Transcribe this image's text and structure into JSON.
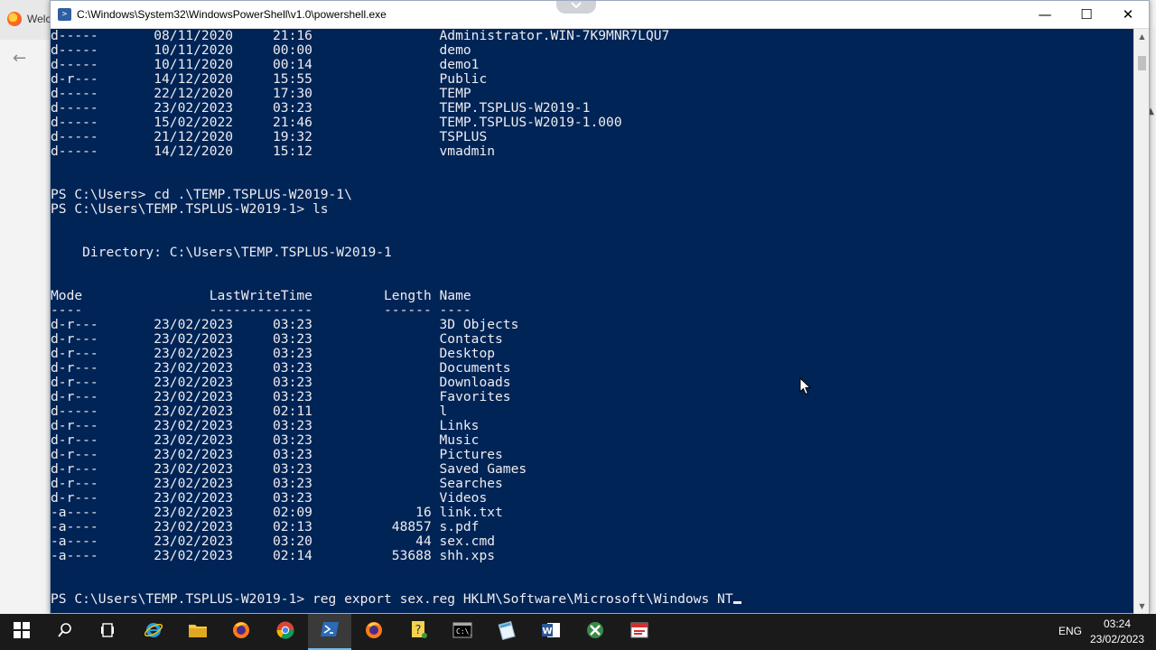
{
  "background_browser": {
    "tab_title": "Welc",
    "back_glyph": "←"
  },
  "window": {
    "title": "C:\\Windows\\System32\\WindowsPowerShell\\v1.0\\powershell.exe",
    "minimize_glyph": "—",
    "maximize_glyph": "☐",
    "close_glyph": "✕"
  },
  "console": {
    "lines": [
      "d-----       08/11/2020     21:16                Administrator.WIN-7K9MNR7LQU7",
      "d-----       10/11/2020     00:00                demo",
      "d-----       10/11/2020     00:14                demo1",
      "d-r---       14/12/2020     15:55                Public",
      "d-----       22/12/2020     17:30                TEMP",
      "d-----       23/02/2023     03:23                TEMP.TSPLUS-W2019-1",
      "d-----       15/02/2022     21:46                TEMP.TSPLUS-W2019-1.000",
      "d-----       21/12/2020     19:32                TSPLUS",
      "d-----       14/12/2020     15:12                vmadmin",
      "",
      "",
      "PS C:\\Users> cd .\\TEMP.TSPLUS-W2019-1\\",
      "PS C:\\Users\\TEMP.TSPLUS-W2019-1> ls",
      "",
      "",
      "    Directory: C:\\Users\\TEMP.TSPLUS-W2019-1",
      "",
      "",
      "Mode                LastWriteTime         Length Name",
      "----                -------------         ------ ----",
      "d-r---       23/02/2023     03:23                3D Objects",
      "d-r---       23/02/2023     03:23                Contacts",
      "d-r---       23/02/2023     03:23                Desktop",
      "d-r---       23/02/2023     03:23                Documents",
      "d-r---       23/02/2023     03:23                Downloads",
      "d-r---       23/02/2023     03:23                Favorites",
      "d-----       23/02/2023     02:11                l",
      "d-r---       23/02/2023     03:23                Links",
      "d-r---       23/02/2023     03:23                Music",
      "d-r---       23/02/2023     03:23                Pictures",
      "d-r---       23/02/2023     03:23                Saved Games",
      "d-r---       23/02/2023     03:23                Searches",
      "d-r---       23/02/2023     03:23                Videos",
      "-a----       23/02/2023     02:09             16 link.txt",
      "-a----       23/02/2023     02:13          48857 s.pdf",
      "-a----       23/02/2023     03:20             44 sex.cmd",
      "-a----       23/02/2023     02:14          53688 shh.xps",
      "",
      "",
      "PS C:\\Users\\TEMP.TSPLUS-W2019-1> reg export sex.reg HKLM\\Software\\Microsoft\\Windows NT"
    ]
  },
  "taskbar": {
    "apps": [
      {
        "name": "start-button",
        "icon": "windows-logo"
      },
      {
        "name": "search-button",
        "icon": "search-icon"
      },
      {
        "name": "task-view-button",
        "icon": "task-view-icon"
      },
      {
        "name": "edge-button",
        "icon": "internet-explorer-icon"
      },
      {
        "name": "file-explorer-button",
        "icon": "folder-icon"
      },
      {
        "name": "firefox-button",
        "icon": "firefox-icon"
      },
      {
        "name": "chrome-button",
        "icon": "chrome-icon"
      },
      {
        "name": "powershell-button",
        "icon": "powershell-icon"
      },
      {
        "name": "firefox-2-button",
        "icon": "firefox-icon"
      },
      {
        "name": "help-button",
        "icon": "help-icon"
      },
      {
        "name": "cmd-button",
        "icon": "cmd-icon"
      },
      {
        "name": "notepad-button",
        "icon": "notepad-icon"
      },
      {
        "name": "word-button",
        "icon": "word-icon"
      },
      {
        "name": "remote-button",
        "icon": "remote-icon"
      },
      {
        "name": "pdf-button",
        "icon": "pdf-icon"
      }
    ],
    "lang": "ENG",
    "time": "03:24",
    "date": "23/02/2023"
  },
  "colors": {
    "console_bg": "#012456",
    "console_fg": "#eeedf0",
    "taskbar_bg": "#1a1a1a"
  }
}
